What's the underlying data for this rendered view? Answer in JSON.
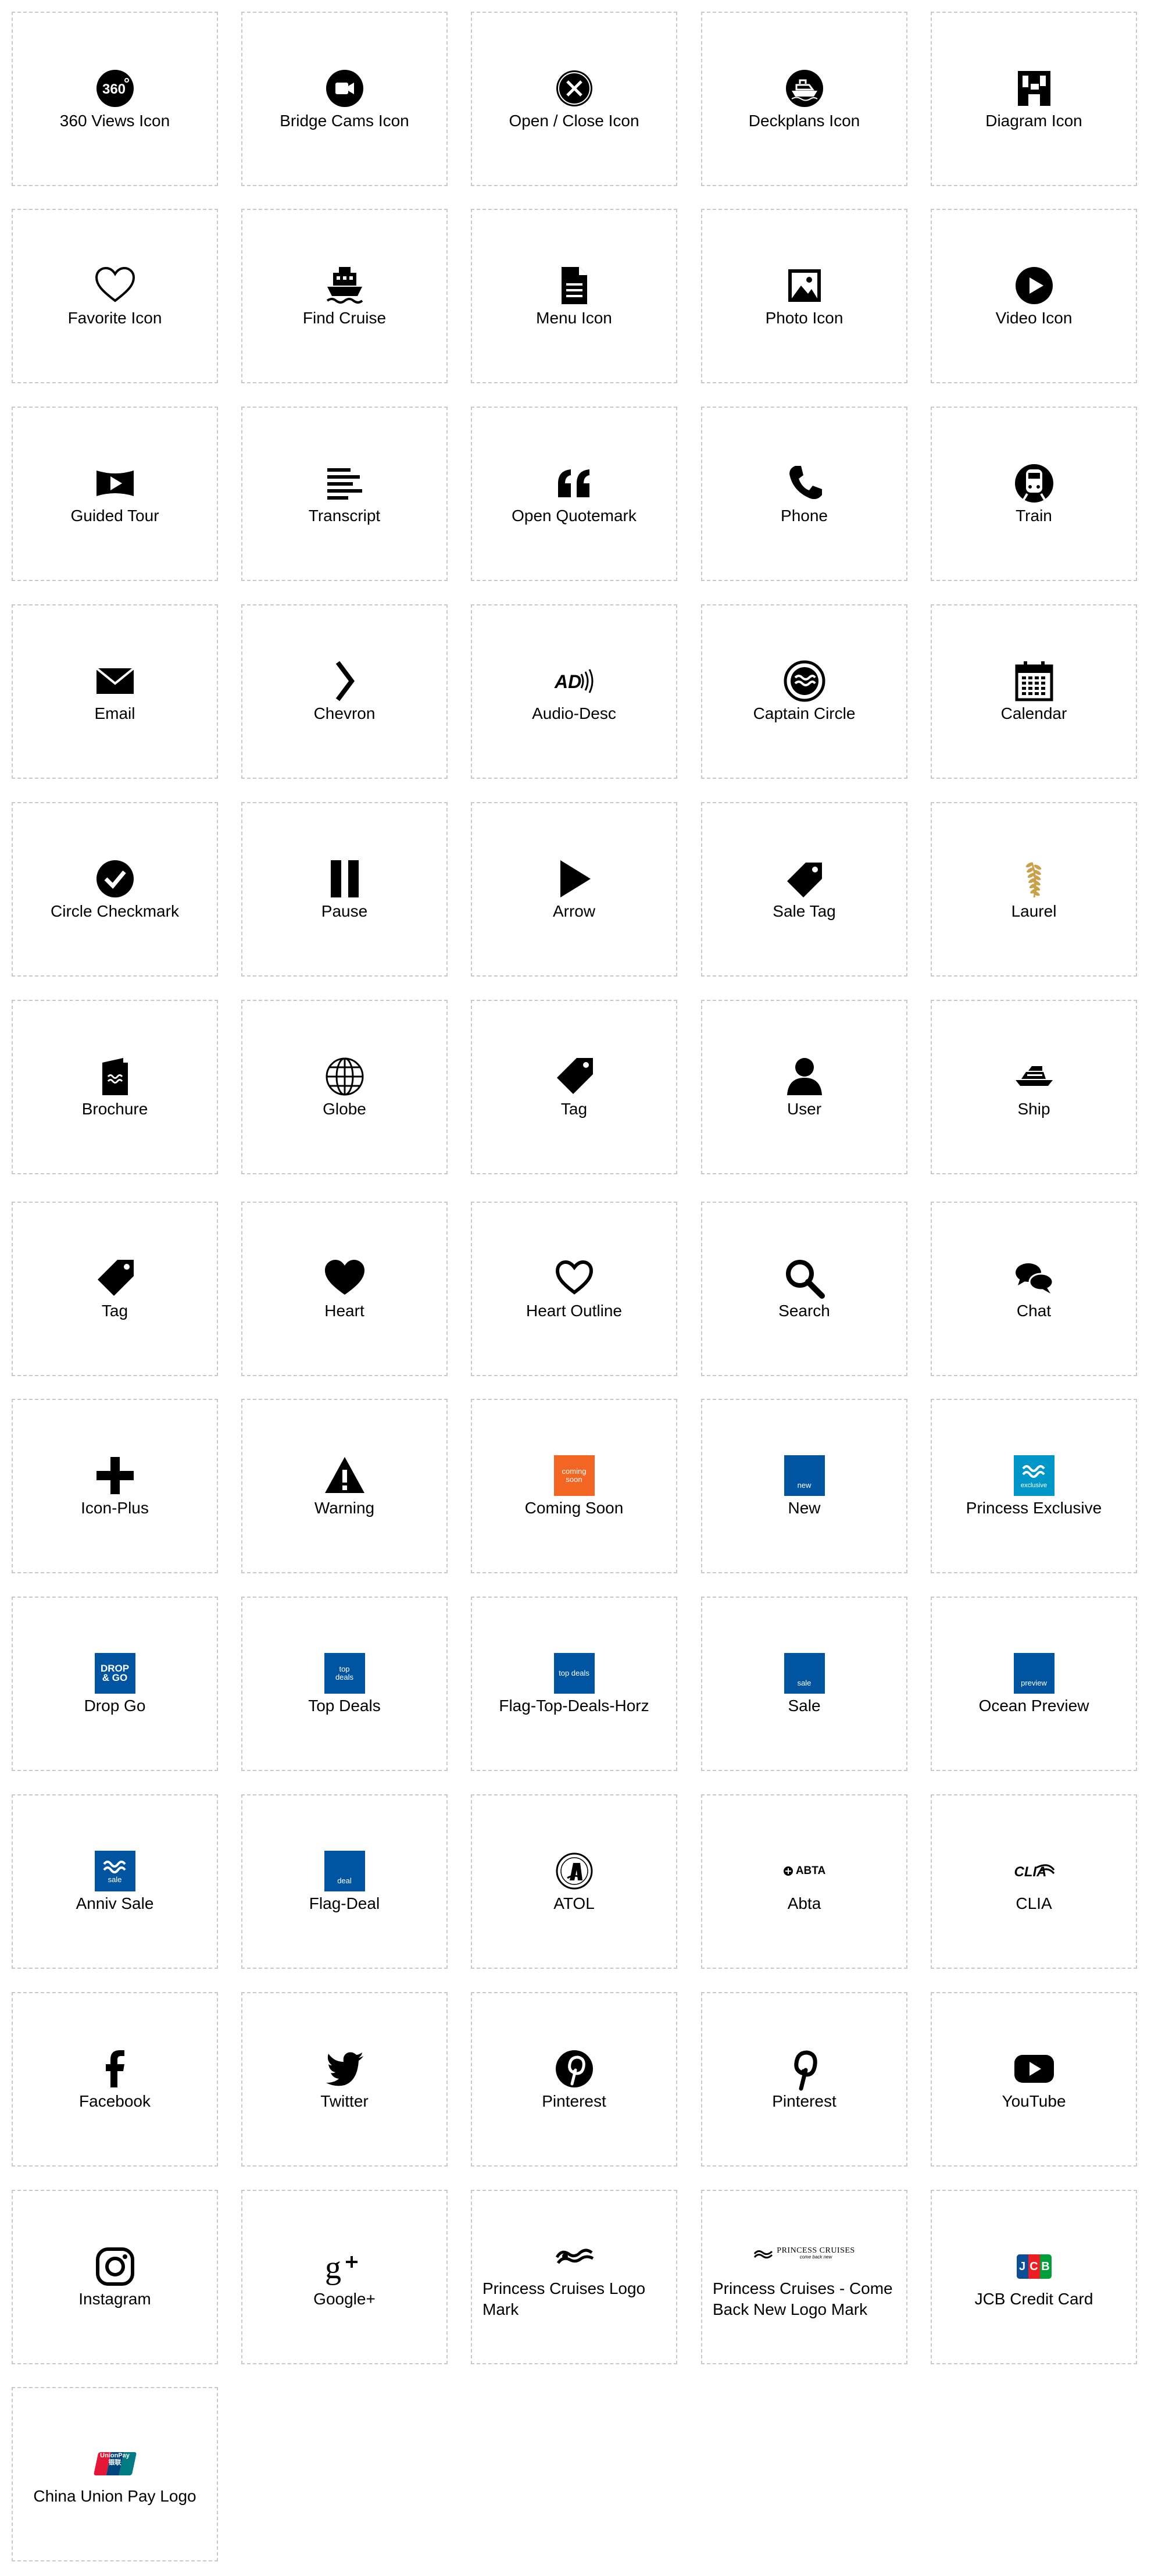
{
  "tiles": [
    {
      "label": "360 Views Icon",
      "icon": "360-views-icon"
    },
    {
      "label": "Bridge Cams Icon",
      "icon": "bridge-cams-icon"
    },
    {
      "label": "Open / Close Icon",
      "icon": "open-close-icon"
    },
    {
      "label": "Deckplans Icon",
      "icon": "deckplans-icon"
    },
    {
      "label": "Diagram Icon",
      "icon": "diagram-icon"
    },
    {
      "label": "Favorite Icon",
      "icon": "favorite-icon"
    },
    {
      "label": "Find Cruise",
      "icon": "find-cruise-icon"
    },
    {
      "label": "Menu Icon",
      "icon": "menu-icon"
    },
    {
      "label": "Photo Icon",
      "icon": "photo-icon"
    },
    {
      "label": "Video Icon",
      "icon": "video-icon"
    },
    {
      "label": "Guided Tour",
      "icon": "guided-tour-icon"
    },
    {
      "label": "Transcript",
      "icon": "transcript-icon"
    },
    {
      "label": "Open Quotemark",
      "icon": "open-quotemark-icon"
    },
    {
      "label": "Phone",
      "icon": "phone-icon"
    },
    {
      "label": "Train",
      "icon": "train-icon"
    },
    {
      "label": "Email",
      "icon": "email-icon"
    },
    {
      "label": "Chevron",
      "icon": "chevron-icon"
    },
    {
      "label": "Audio-Desc",
      "icon": "audio-desc-icon",
      "text": "AD"
    },
    {
      "label": "Captain Circle",
      "icon": "captain-circle-icon"
    },
    {
      "label": "Calendar",
      "icon": "calendar-icon"
    },
    {
      "label": "Circle Checkmark",
      "icon": "circle-checkmark-icon"
    },
    {
      "label": "Pause",
      "icon": "pause-icon"
    },
    {
      "label": "Arrow",
      "icon": "arrow-icon"
    },
    {
      "label": "Sale Tag",
      "icon": "sale-tag-icon"
    },
    {
      "label": "Laurel",
      "icon": "laurel-icon"
    },
    {
      "label": "Brochure",
      "icon": "brochure-icon"
    },
    {
      "label": "Globe",
      "icon": "globe-icon"
    },
    {
      "label": "Tag",
      "icon": "tag-icon"
    },
    {
      "label": "User",
      "icon": "user-icon"
    },
    {
      "label": "Ship",
      "icon": "ship-icon"
    },
    {
      "label": "Tag",
      "icon": "tag-icon"
    },
    {
      "label": "Heart",
      "icon": "heart-icon"
    },
    {
      "label": "Heart Outline",
      "icon": "heart-outline-icon"
    },
    {
      "label": "Search",
      "icon": "search-icon"
    },
    {
      "label": "Chat",
      "icon": "chat-icon"
    },
    {
      "label": "Icon-Plus",
      "icon": "plus-icon"
    },
    {
      "label": "Warning",
      "icon": "warning-icon"
    },
    {
      "label": "Coming Soon",
      "icon": "coming-soon-flag-icon",
      "text": "coming soon"
    },
    {
      "label": "New",
      "icon": "new-flag-icon",
      "text": "new"
    },
    {
      "label": "Princess Exclusive",
      "icon": "princess-exclusive-flag-icon",
      "text": "exclusive"
    },
    {
      "label": "Drop Go",
      "icon": "drop-go-flag-icon",
      "text": "DROP & GO"
    },
    {
      "label": "Top Deals",
      "icon": "top-deals-flag-icon",
      "text": "top deals"
    },
    {
      "label": "Flag-Top-Deals-Horz",
      "icon": "top-deals-horizontal-flag-icon",
      "text": "top deals"
    },
    {
      "label": "Sale",
      "icon": "sale-flag-icon",
      "text": "sale"
    },
    {
      "label": "Ocean Preview",
      "icon": "ocean-preview-flag-icon",
      "text": "preview"
    },
    {
      "label": "Anniv Sale",
      "icon": "anniv-sale-flag-icon",
      "text": "sale"
    },
    {
      "label": "Flag-Deal",
      "icon": "deal-flag-icon",
      "text": "deal"
    },
    {
      "label": "ATOL",
      "icon": "atol-logo-icon"
    },
    {
      "label": "Abta",
      "icon": "abta-logo-icon",
      "text": "ABTA"
    },
    {
      "label": "CLIA",
      "icon": "clia-logo-icon",
      "text": "CLIA"
    },
    {
      "label": "Facebook",
      "icon": "facebook-icon"
    },
    {
      "label": "Twitter",
      "icon": "twitter-icon"
    },
    {
      "label": "Pinterest",
      "icon": "pinterest-circle-icon"
    },
    {
      "label": "Pinterest",
      "icon": "pinterest-icon"
    },
    {
      "label": "YouTube",
      "icon": "youtube-icon"
    },
    {
      "label": "Instagram",
      "icon": "instagram-icon"
    },
    {
      "label": "Google+",
      "icon": "google-plus-icon"
    },
    {
      "label": "Princess Cruises Logo Mark",
      "icon": "princess-logo-mark-icon"
    },
    {
      "label": "Princess Cruises - Come Back New Logo Mark",
      "icon": "princess-come-back-new-logo-icon",
      "text": "PRINCESS CRUISES",
      "subtext": "come back new"
    },
    {
      "label": "JCB Credit Card",
      "icon": "jcb-card-icon",
      "text": "JCB"
    },
    {
      "label": "China Union Pay Logo",
      "icon": "unionpay-logo-icon",
      "text": "UnionPay",
      "subtext": "银联"
    }
  ],
  "colors": {
    "icon": "#000000",
    "flag_blue": "#0054a0",
    "flag_orange": "#f26522",
    "flag_teal": "#0096c8",
    "laurel_gold": "#c8a14a",
    "border": "#c8c8c8"
  }
}
